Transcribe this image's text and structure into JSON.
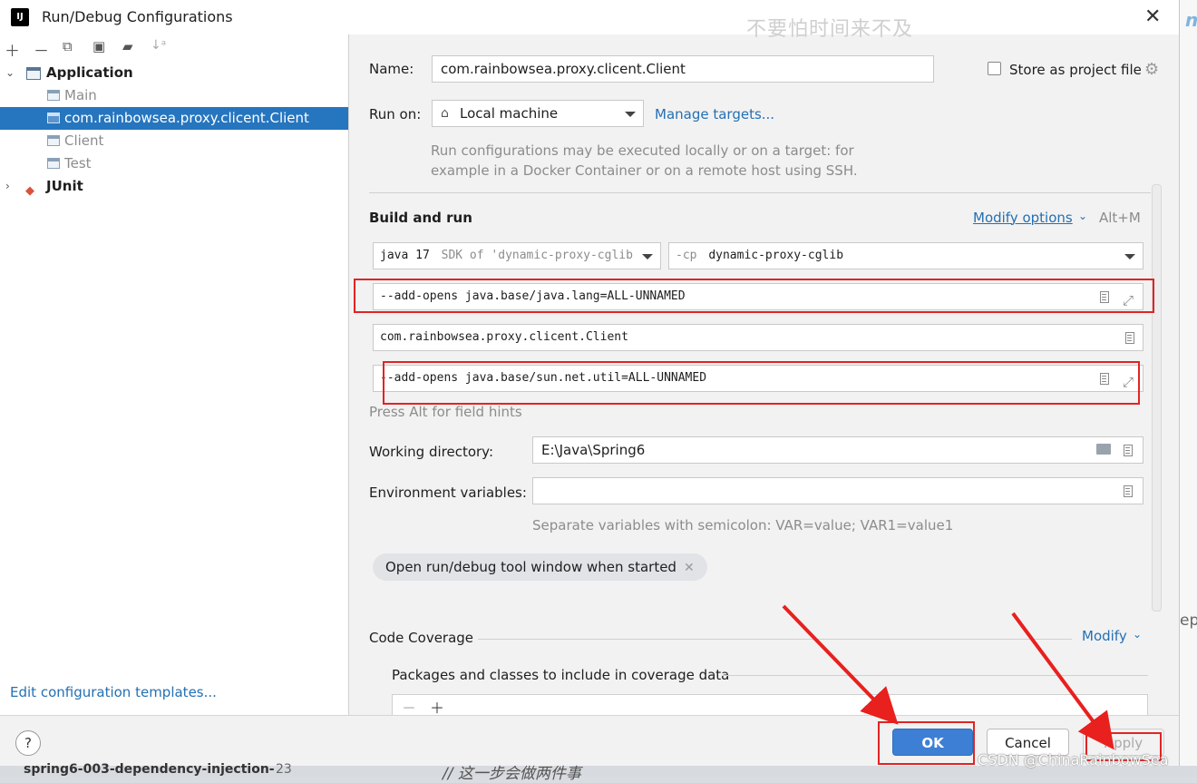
{
  "window": {
    "title": "Run/Debug Configurations",
    "watermark": "不要怕时间来不及"
  },
  "sidebar": {
    "items": [
      {
        "label": "Application",
        "kind": "group"
      },
      {
        "label": "Main",
        "kind": "config"
      },
      {
        "label": "com.rainbowsea.proxy.clicent.Client",
        "kind": "config",
        "selected": true
      },
      {
        "label": "Client",
        "kind": "config"
      },
      {
        "label": "Test",
        "kind": "config"
      },
      {
        "label": "JUnit",
        "kind": "group"
      }
    ],
    "edit_templates": "Edit configuration templates..."
  },
  "form": {
    "name_label": "Name:",
    "name_value": "com.rainbowsea.proxy.clicent.Client",
    "store_label": "Store as project file",
    "run_on_label": "Run on:",
    "run_on_value": "Local machine",
    "manage_targets": "Manage targets...",
    "run_on_hint_1": "Run configurations may be executed locally or on a target: for",
    "run_on_hint_2": "example in a Docker Container or on a remote host using SSH.",
    "build_run_title": "Build and run",
    "modify_options": "Modify options",
    "modify_shortcut": "Alt+M",
    "jre_version": "java 17",
    "jre_sdk": "SDK of 'dynamic-proxy-cglib",
    "cp_flag": "-cp",
    "cp_value": "dynamic-proxy-cglib",
    "vm_options": "--add-opens java.base/java.lang=ALL-UNNAMED",
    "main_class": "com.rainbowsea.proxy.clicent.Client",
    "program_args": "--add-opens java.base/sun.net.util=ALL-UNNAMED",
    "field_hint": "Press Alt for field hints",
    "working_dir_label": "Working directory:",
    "working_dir_value": "E:\\Java\\Spring6",
    "env_label": "Environment variables:",
    "env_value": "",
    "env_hint": "Separate variables with semicolon: VAR=value; VAR1=value1",
    "chip_label": "Open run/debug tool window when started",
    "coverage_title": "Code Coverage",
    "coverage_modify": "Modify",
    "coverage_packages": "Packages and classes to include in coverage data"
  },
  "buttons": {
    "help": "?",
    "ok": "OK",
    "cancel": "Cancel",
    "apply": "Apply"
  },
  "background": {
    "project_item": "spring6-003-dependency-injection-",
    "project_number": "23",
    "code_comment": "// 这一步会做两件事",
    "side_fragment": "ep",
    "csdn_watermark": "CSDN @ChinaRainbowSea"
  },
  "colors": {
    "accent": "#2675bf",
    "link": "#2470b3",
    "annotation": "#e02424"
  }
}
